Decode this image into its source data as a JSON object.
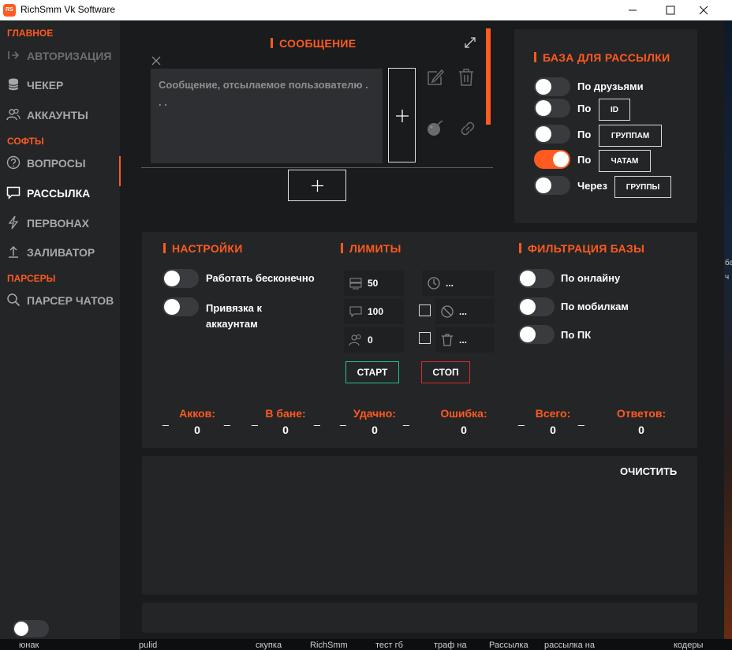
{
  "window": {
    "title": "RichSmm Vk Software",
    "icon_text": "RS",
    "accent": "#ff5a1f"
  },
  "sidebar": {
    "sections": {
      "main": "ГЛАВНОЕ",
      "soft": "СОФТЫ",
      "parsers": "ПАРСЕРЫ"
    },
    "items": [
      {
        "label": "АВТОРИЗАЦИЯ",
        "icon": "login-icon",
        "state": "disabled"
      },
      {
        "label": "ЧЕКЕР",
        "icon": "database-icon",
        "state": "normal"
      },
      {
        "label": "АККАУНТЫ",
        "icon": "users-icon",
        "state": "normal"
      },
      {
        "label": "ВОПРОСЫ",
        "icon": "question-icon",
        "state": "normal"
      },
      {
        "label": "РАССЫЛКА",
        "icon": "message-icon",
        "state": "active"
      },
      {
        "label": "ПЕРВОНАХ",
        "icon": "lightning-icon",
        "state": "normal"
      },
      {
        "label": "ЗАЛИВАТОР",
        "icon": "upload-icon",
        "state": "normal"
      },
      {
        "label": "ПАРСЕР ЧАТОВ",
        "icon": "search-icon",
        "state": "normal"
      }
    ]
  },
  "message": {
    "title": "СООБЩЕНИЕ",
    "placeholder": "Сообщение, отсылаемое пользователю . . ."
  },
  "base": {
    "title": "БАЗА ДЛЯ РАССЫЛКИ",
    "options": [
      {
        "label": "По друзьями",
        "box": "",
        "on": false
      },
      {
        "label": "По",
        "box": "ID",
        "on": false
      },
      {
        "label": "По",
        "box": "ГРУППАМ",
        "on": false
      },
      {
        "label": "По",
        "box": "ЧАТАМ",
        "on": true
      },
      {
        "label": "Через",
        "box": "ГРУППЫ",
        "on": false
      }
    ]
  },
  "settings": {
    "title": "НАСТРОЙКИ",
    "forever": "Работать бесконечно",
    "binding": "Привязка к аккаунтам"
  },
  "limits": {
    "title": "ЛИМИТЫ",
    "messages": "50",
    "chats": "100",
    "users": "0",
    "delay": "...",
    "ban": "...",
    "delete": "..."
  },
  "filter": {
    "title": "ФИЛЬТРАЦИЯ БАЗЫ",
    "online": "По онлайну",
    "mobile": "По мобилкам",
    "pc": "По ПК"
  },
  "actions": {
    "start": "СТАРТ",
    "stop": "СТОП",
    "clear": "ОЧИСТИТЬ"
  },
  "stats": [
    {
      "label": "Акков:",
      "value": "0"
    },
    {
      "label": "В бане:",
      "value": "0"
    },
    {
      "label": "Удачно:",
      "value": "0"
    },
    {
      "label": "Ошибка:",
      "value": "0"
    },
    {
      "label": "Всего:",
      "value": "0"
    },
    {
      "label": "Ответов:",
      "value": "0"
    }
  ],
  "taskbar": [
    "юнак",
    "pulid",
    "скупка",
    "RichSmm",
    "тест гб",
    "траф на",
    "Рассылка",
    "рассылка на",
    "кодеры"
  ]
}
